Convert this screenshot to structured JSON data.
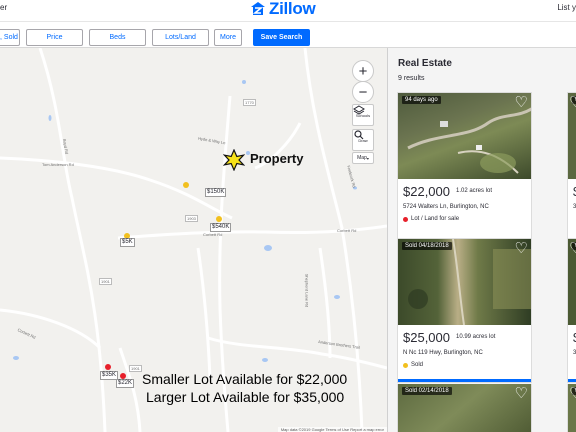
{
  "header": {
    "left_text": "er",
    "logo_text": "Zillow",
    "right_text": "List y"
  },
  "filters": {
    "sold_label": ", Sold",
    "price_label": "Price",
    "beds_label": "Beds",
    "lots_label": "Lots/Land",
    "more_label": "More",
    "save_label": "Save Search"
  },
  "map": {
    "controls": {
      "zoom_in": "+",
      "zoom_out": "−",
      "schools_label": "Schools",
      "draw_label": "Draw",
      "map_type_label": "Map"
    },
    "markers": [
      {
        "label": "$150K",
        "color": "#f2c01e"
      },
      {
        "label": "$540K",
        "color": "#f2c01e"
      },
      {
        "label": "$5K",
        "color": "#f2c01e"
      },
      {
        "label": "$35K",
        "color": "#e7202b"
      },
      {
        "label": "$22K",
        "color": "#e7202b"
      }
    ],
    "road_labels": {
      "r1": "1770",
      "r2": "Hyde & Way Ln",
      "r3": "Tom Anderson Rd",
      "r4": "Boyd Rd",
      "r5": "1903",
      "r6": "Corbett Rd",
      "r7": "Corbett Rd",
      "r8": "1901",
      "r9": "Corbett Rd",
      "r10": "Anderson Brothers Trail",
      "r11": "1901",
      "r12": "Frederick Rd",
      "r13": "Shepherd Lane Rd"
    },
    "property_label": "Property",
    "annotation_line1": "Smaller Lot Available for $22,000",
    "annotation_line2": "Larger Lot Available for $35,000",
    "footer": "Map data ©2019 Google   Terms of Use   Report a map error"
  },
  "panel": {
    "title": "Real Estate",
    "count": "9 results",
    "listings": [
      {
        "badge": "94 days ago",
        "price": "$22,000",
        "acres": "1.02 acres lot",
        "address": "5724 Walters Ln, Burlington, NC",
        "status": "Lot / Land for sale",
        "status_color": "#e7202b"
      },
      {
        "badge": "Sold 04/18/2018",
        "price": "$25,000",
        "acres": "10.99 acres lot",
        "address": "N Nc 119 Hwy, Burlington, NC",
        "status": "Sold",
        "status_color": "#f2c01e"
      },
      {
        "badge": "Sold 02/14/2018",
        "price": "",
        "acres": "",
        "address": "",
        "status": "",
        "status_color": "#f2c01e"
      }
    ],
    "partial_cards": [
      {
        "badge": "S",
        "price": "$",
        "address": "3",
        "status": ""
      },
      {
        "badge": "So",
        "price": "$",
        "address": "3",
        "status": ""
      },
      {
        "badge": "So",
        "price": "",
        "address": "",
        "status": ""
      }
    ]
  },
  "colors": {
    "brand": "#006aff",
    "for_sale": "#e7202b",
    "sold": "#f2c01e"
  }
}
